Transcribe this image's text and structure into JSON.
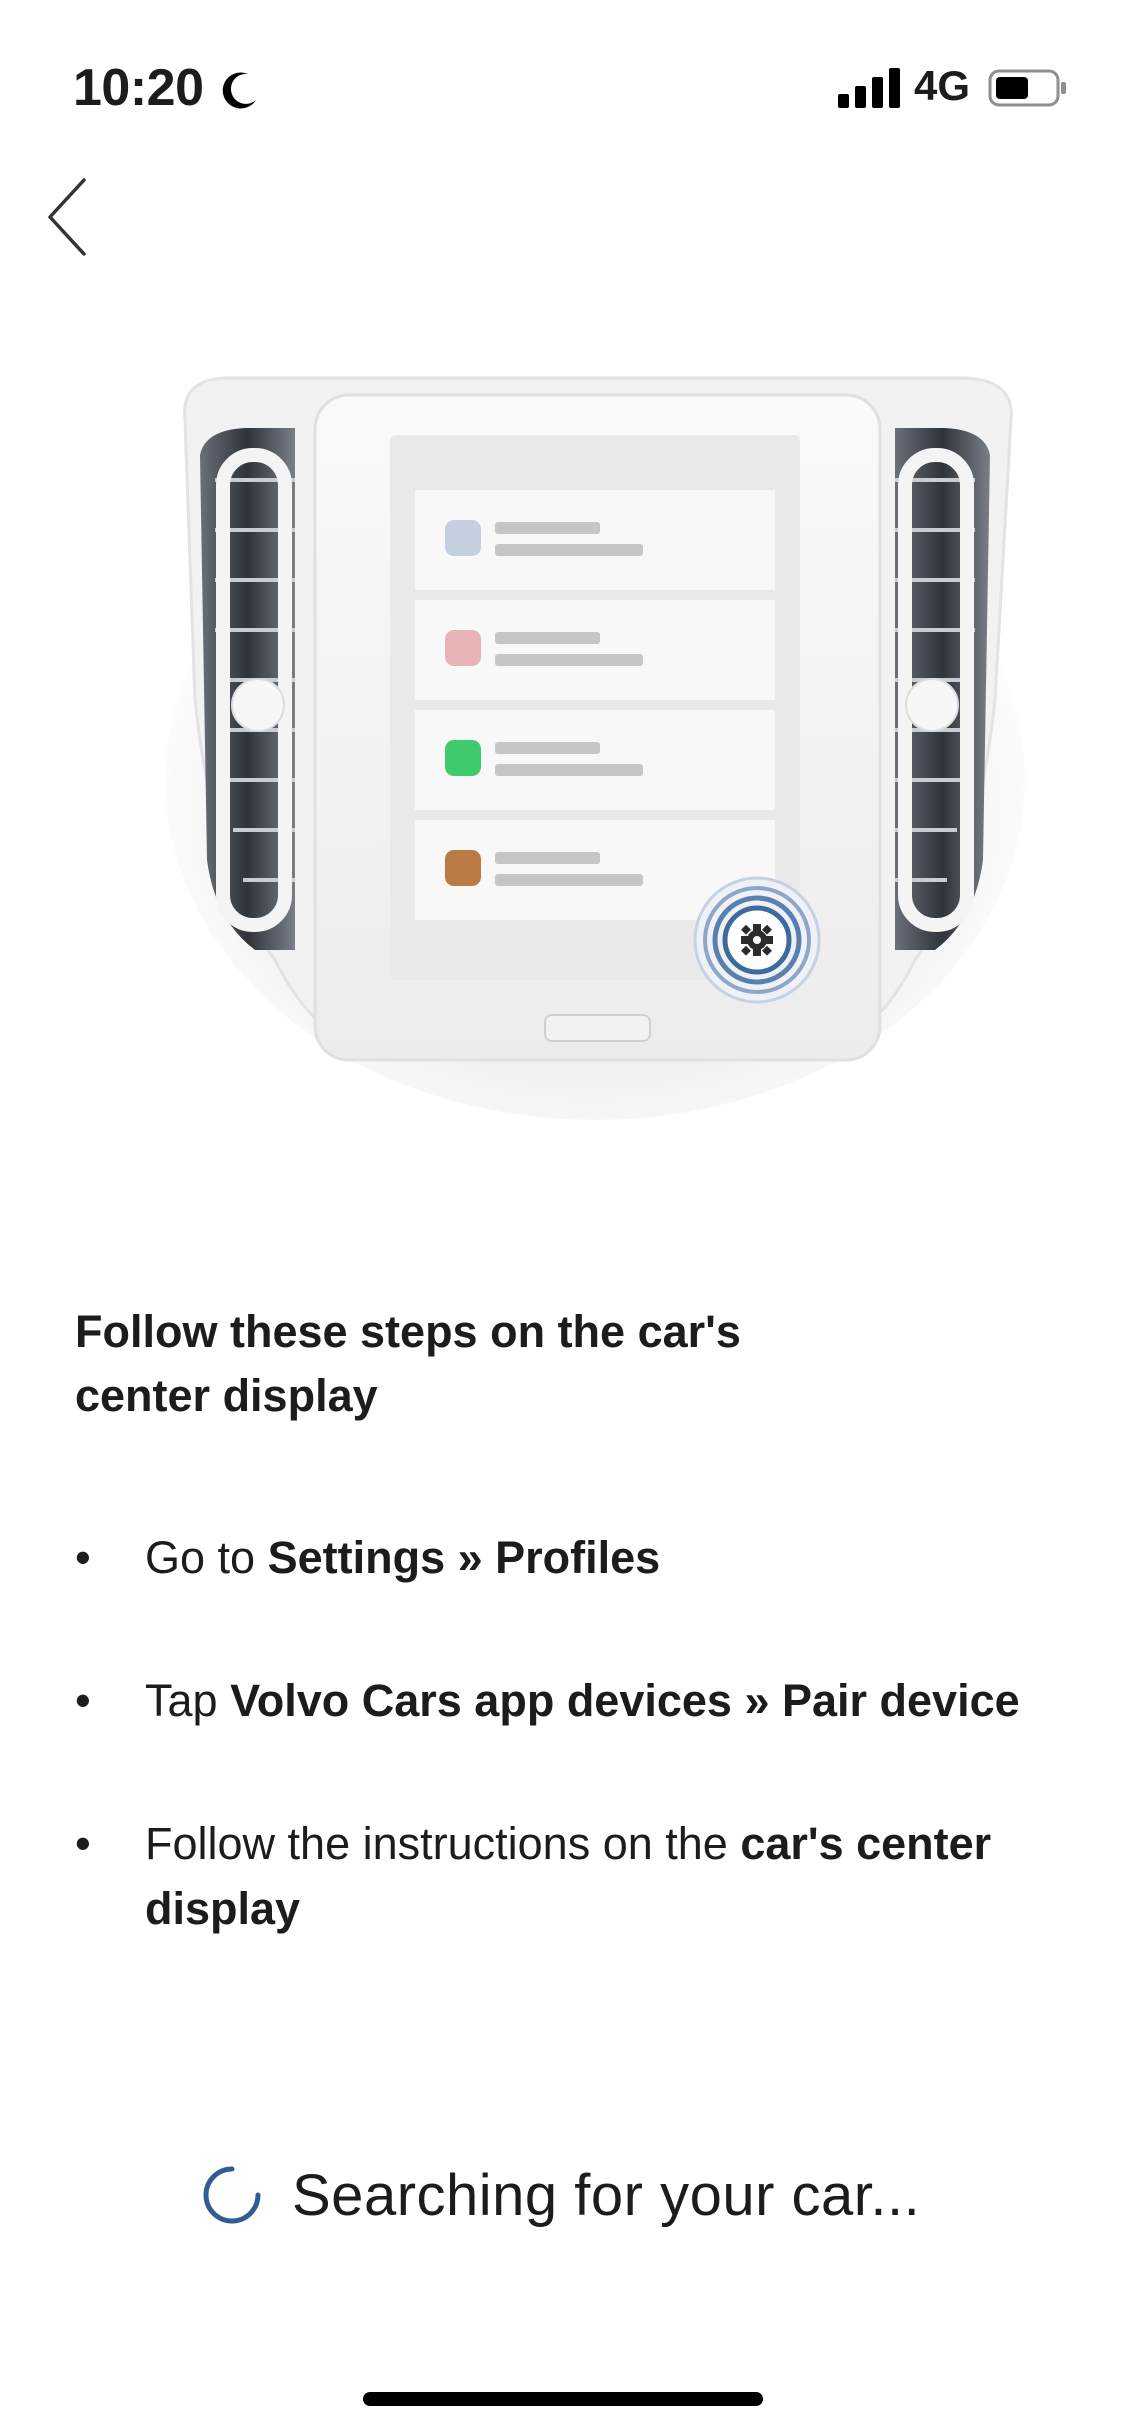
{
  "status_bar": {
    "time": "10:20",
    "network": "4G"
  },
  "navigation": {
    "back_icon": "chevron-left-icon"
  },
  "illustration": {
    "description_icon": "car-center-display",
    "list_item_colors": [
      "#c4d0e0",
      "#e8b4b6",
      "#3fcb6b",
      "#b97b43"
    ],
    "gear_icon": "gear-icon",
    "accent_ring_color": "#3f6a9c"
  },
  "instructions": {
    "heading": "Follow these steps on the car's center display",
    "steps": [
      {
        "bullet": "•",
        "plain": "Go to ",
        "bold": "Settings » Profiles",
        "after": ""
      },
      {
        "bullet": "•",
        "plain": "Tap ",
        "bold": "Volvo Cars app devices » Pair device",
        "after": ""
      },
      {
        "bullet": "•",
        "plain": "Follow the instructions on the ",
        "bold": "car's center display",
        "after": ""
      }
    ]
  },
  "status": {
    "spinner_icon": "loading-spinner-icon",
    "text": "Searching for your car..."
  },
  "colors": {
    "accent": "#2f5d93",
    "text": "#1c1c1e",
    "background": "#ffffff"
  }
}
